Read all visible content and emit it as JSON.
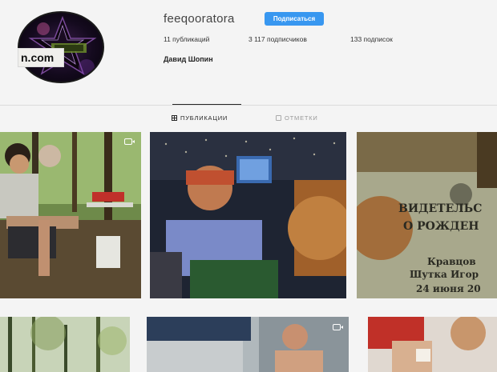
{
  "profile": {
    "username": "feeqooratora",
    "follow_label": "Подписаться",
    "stats": {
      "posts": "11 публикаций",
      "followers": "3 117 подписчиков",
      "following": "133 подписок"
    },
    "full_name": "Давид Шопин",
    "overlay_domain_text": "n.com"
  },
  "tabs": [
    {
      "label": "ПУБЛИКАЦИИ",
      "icon": "grid-icon",
      "active": true
    },
    {
      "label": "ОТМЕТКИ",
      "icon": "tag-icon",
      "active": false
    }
  ],
  "posts": [
    {
      "id": "forest-camp",
      "video": true
    },
    {
      "id": "bar-selfie",
      "video": false
    },
    {
      "id": "certificate",
      "video": false,
      "text_lines": [
        "ВИДЕТЕЛЬС",
        "О РОЖДЕН",
        "Кравцов",
        "Шутка Игор",
        "24 июня 20"
      ]
    },
    {
      "id": "trees",
      "video": false
    },
    {
      "id": "dormitory",
      "video": true
    },
    {
      "id": "red-hat",
      "video": false
    }
  ],
  "colors": {
    "follow_button": "#3897f0",
    "background": "#f4f4f4"
  }
}
